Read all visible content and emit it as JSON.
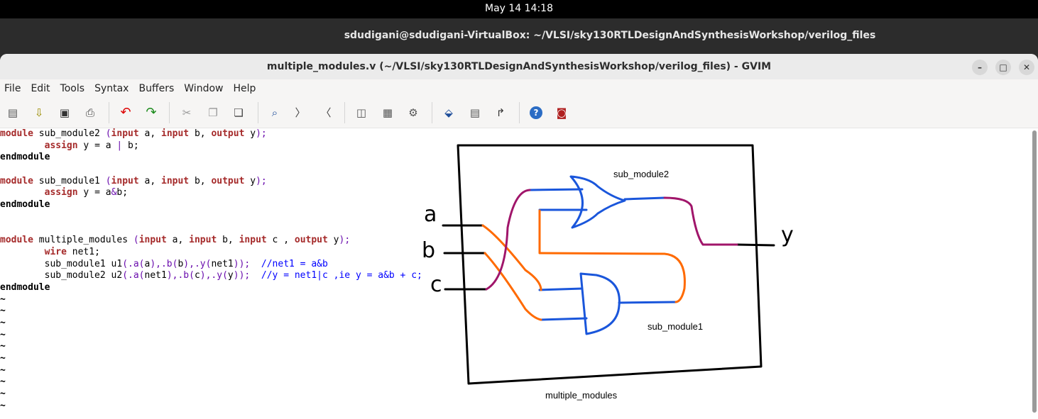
{
  "system": {
    "clock": "May 14  14:18"
  },
  "terminal": {
    "title": "sdudigani@sdudigani-VirtualBox: ~/VLSI/sky130RTLDesignAndSynthesisWorkshop/verilog_files"
  },
  "window": {
    "title": "multiple_modules.v (~/VLSI/sky130RTLDesignAndSynthesisWorkshop/verilog_files) - GVIM",
    "minimize": "–",
    "maximize": "□",
    "close": "✕"
  },
  "menu": [
    "File",
    "Edit",
    "Tools",
    "Syntax",
    "Buffers",
    "Window",
    "Help"
  ],
  "toolbar_icons": [
    "open-icon",
    "load-session-icon",
    "save-icon",
    "print-icon",
    "undo-icon",
    "redo-icon",
    "cut-icon",
    "copy-icon",
    "paste-icon",
    "find-replace-icon",
    "find-next-icon",
    "find-prev-icon",
    "load-script-icon",
    "make-icon",
    "run-shell-icon",
    "run-ctags-icon",
    "build-tags-icon",
    "jump-to-tag-icon",
    "help-icon",
    "find-help-icon"
  ],
  "code": {
    "l1": {
      "a": "module",
      "b": " sub_module2 ",
      "c": "(",
      "d": "input",
      "e": " a, ",
      "f": "input",
      "g": " b, ",
      "h": "output",
      "i": " y",
      "j": ");"
    },
    "l2": {
      "a": "        ",
      "b": "assign",
      "c": " y = a ",
      "d": "|",
      "e": " b;"
    },
    "l3": "endmodule",
    "l5": {
      "a": "module",
      "b": " sub_module1 ",
      "c": "(",
      "d": "input",
      "e": " a, ",
      "f": "input",
      "g": " b, ",
      "h": "output",
      "i": " y",
      "j": ");"
    },
    "l6": {
      "a": "        ",
      "b": "assign",
      "c": " y = a",
      "d": "&",
      "e": "b;"
    },
    "l7": "endmodule",
    "l10": {
      "a": "module",
      "b": " multiple_modules ",
      "c": "(",
      "d": "input",
      "e": " a, ",
      "f": "input",
      "g": " b, ",
      "h": "input",
      "i": " c , ",
      "j": "output",
      "k": " y",
      "l": ");"
    },
    "l11": {
      "a": "        ",
      "b": "wire",
      "c": " net1;"
    },
    "l12": {
      "a": "        sub_module1 u1",
      "b": "(.a(",
      "c": "a",
      "d": "),.b(",
      "e": "b",
      "f": "),.y(",
      "g": "net1",
      "h": "));",
      "i": "  //net1 = a&b"
    },
    "l13": {
      "a": "        sub_module2 u2",
      "b": "(.a(",
      "c": "net1",
      "d": "),.b(",
      "e": "c",
      "f": "),.y(",
      "g": "y",
      "h": "));",
      "i": "  //y = net1|c ,ie y = a&b + c;"
    },
    "l14": "endmodule",
    "tilde": "~"
  },
  "diagram": {
    "label_sub_module2": "sub_module2",
    "label_sub_module1": "sub_module1",
    "label_multiple_modules": "multiple_modules",
    "input_a": "a",
    "input_b": "b",
    "input_c": "c",
    "output_y": "y",
    "colors": {
      "box": "#000000",
      "gate": "#1a56db",
      "orange": "#ff6a00",
      "magenta": "#a0156a"
    }
  }
}
